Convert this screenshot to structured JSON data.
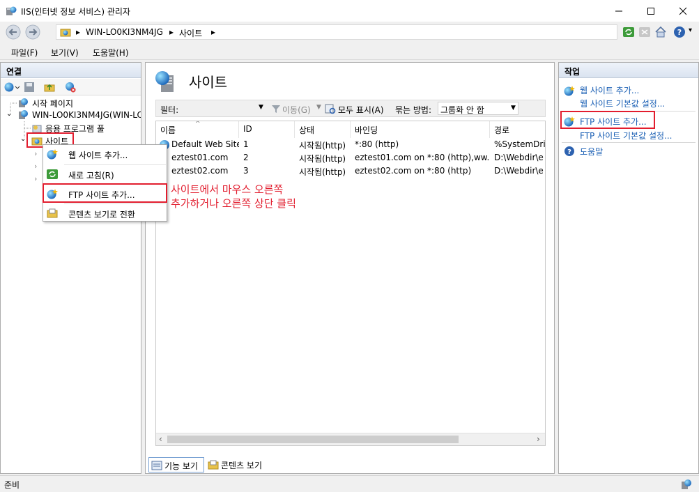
{
  "window": {
    "title": "IIS(인터넷 정보 서비스) 관리자",
    "controls": {
      "minimize": "—",
      "maximize": "☐",
      "close": "✕"
    }
  },
  "address": {
    "crumbs": [
      "WIN-LO0KI3NM4JG",
      "사이트"
    ]
  },
  "menu": {
    "file": "파일(F)",
    "view": "보기(V)",
    "help": "도움말(H)"
  },
  "connections": {
    "title": "연결",
    "tree": {
      "start_page": "시작 페이지",
      "server": "WIN-LO0KI3NM4JG(WIN-LO(",
      "app_pools": "응용 프로그램 풀",
      "sites": "사이트"
    }
  },
  "main": {
    "title": "사이트",
    "filter": {
      "label": "필터:",
      "go": "이동(G)",
      "show_all": "모두 표시(A)",
      "group_by_label": "묶는 방법:",
      "group_by_value": "그룹화 안 함"
    },
    "columns": [
      "이름",
      "ID",
      "상태",
      "바인딩",
      "경로"
    ],
    "rows": [
      {
        "name": "Default Web Site",
        "id": "1",
        "status": "시작됨(http)",
        "binding": "*:80 (http)",
        "path": "%SystemDrive"
      },
      {
        "name": "eztest01.com",
        "id": "2",
        "status": "시작됨(http)",
        "binding": "eztest01.com on *:80 (http),ww...",
        "path": "D:\\Webdir\\e"
      },
      {
        "name": "eztest02.com",
        "id": "3",
        "status": "시작됨(http)",
        "binding": "eztest02.com on *:80 (http)",
        "path": "D:\\Webdir\\e"
      }
    ],
    "view_tabs": {
      "features": "기능 보기",
      "content": "콘텐츠 보기"
    }
  },
  "context_menu": {
    "add_website": "웹 사이트 추가...",
    "refresh": "새로 고침(R)",
    "add_ftp": "FTP 사이트 추가...",
    "content_view": "콘텐츠 보기로 전환"
  },
  "annotation": {
    "line1": "사이트에서 마우스 오른쪽",
    "line2": "추가하거나 오른쪽 상단 클릭"
  },
  "actions": {
    "title": "작업",
    "add_website": "웹 사이트 추가...",
    "website_defaults": "웹 사이트 기본값 설정...",
    "add_ftp": "FTP 사이트 추가...",
    "ftp_defaults": "FTP 사이트 기본값 설정...",
    "help": "도움말"
  },
  "status": {
    "text": "준비"
  },
  "colors": {
    "accent_link": "#1a5fb4",
    "highlight_red": "#e21d2e"
  }
}
